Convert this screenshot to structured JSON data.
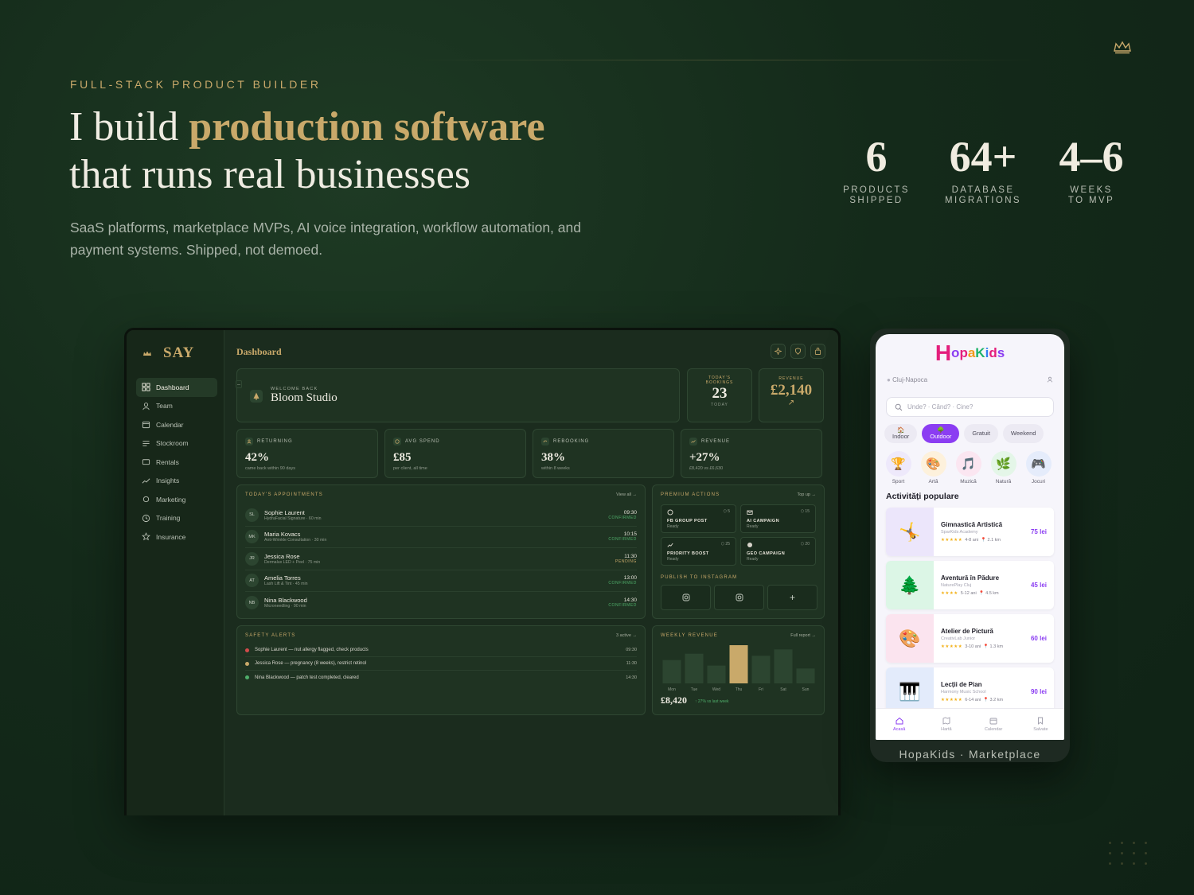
{
  "hero": {
    "eyebrow": "FULL-STACK PRODUCT BUILDER",
    "headline_pre": "I build ",
    "headline_highlight": "production software",
    "headline_line2": "that runs real businesses",
    "subcopy": "SaaS platforms, marketplace MVPs, AI voice integration, workflow automation, and payment systems. Shipped, not demoed.",
    "accent_color": "#c9a96a"
  },
  "stats": [
    {
      "value": "6",
      "label1": "PRODUCTS",
      "label2": "SHIPPED"
    },
    {
      "value": "64+",
      "label1": "DATABASE",
      "label2": "MIGRATIONS"
    },
    {
      "value": "4–6",
      "label1": "WEEKS",
      "label2": "TO MVP"
    }
  ],
  "dashboard": {
    "brand": "SAY",
    "page_title": "Dashboard",
    "nav": [
      {
        "label": "Dashboard",
        "icon": "grid-icon"
      },
      {
        "label": "Team",
        "icon": "user-icon"
      },
      {
        "label": "Calendar",
        "icon": "calendar-icon"
      },
      {
        "label": "Stockroom",
        "icon": "list-icon"
      },
      {
        "label": "Rentals",
        "icon": "box-icon"
      },
      {
        "label": "Insights",
        "icon": "trend-icon"
      },
      {
        "label": "Marketing",
        "icon": "megaphone-icon"
      },
      {
        "label": "Training",
        "icon": "clock-icon"
      },
      {
        "label": "Insurance",
        "icon": "star-icon"
      }
    ],
    "welcome": {
      "label": "WELCOME BACK",
      "name": "Bloom Studio"
    },
    "bookings": {
      "label": "TODAY'S BOOKINGS",
      "value": "23",
      "sub": "TODAY"
    },
    "revenue": {
      "label": "REVENUE",
      "value": "£2,140",
      "arrow": "↗"
    },
    "kpis": [
      {
        "label": "RETURNING",
        "value": "42%",
        "sub": "came back within 90 days"
      },
      {
        "label": "AVG SPEND",
        "value": "£85",
        "sub": "per client, all time"
      },
      {
        "label": "REBOOKING",
        "value": "38%",
        "sub": "within 8 weeks"
      },
      {
        "label": "REVENUE",
        "value": "+27%",
        "sub": "£8,420 vs £6,630"
      }
    ],
    "appointments": {
      "title": "TODAY'S APPOINTMENTS",
      "link": "View all →",
      "items": [
        {
          "initials": "SL",
          "name": "Sophie Laurent",
          "treatment": "HydraFacial Signature · 60 min",
          "time": "09:30",
          "status": "CONFIRMED"
        },
        {
          "initials": "MK",
          "name": "Maria Kovacs",
          "treatment": "Anti-Wrinkle Consultation · 30 min",
          "time": "10:15",
          "status": "CONFIRMED"
        },
        {
          "initials": "JR",
          "name": "Jessica Rose",
          "treatment": "Dermalux LED + Peel · 75 min",
          "time": "11:30",
          "status": "PENDING"
        },
        {
          "initials": "AT",
          "name": "Amelia Torres",
          "treatment": "Lash Lift & Tint · 45 min",
          "time": "13:00",
          "status": "CONFIRMED"
        },
        {
          "initials": "NB",
          "name": "Nina Blackwood",
          "treatment": "Microneedling · 90 min",
          "time": "14:30",
          "status": "CONFIRMED"
        }
      ]
    },
    "premium": {
      "title": "PREMIUM ACTIONS",
      "link": "Top up →",
      "actions": [
        {
          "title": "FB GROUP POST",
          "state": "Ready",
          "cost": "⬡ 5"
        },
        {
          "title": "AI CAMPAIGN",
          "state": "Ready",
          "cost": "⬡ 15"
        },
        {
          "title": "PRIORITY BOOST",
          "state": "Ready",
          "cost": "⬡ 25"
        },
        {
          "title": "GEO CAMPAIGN",
          "state": "Ready",
          "cost": "⬡ 20"
        }
      ],
      "publish_title": "PUBLISH TO INSTAGRAM",
      "plus": "+"
    },
    "alerts": {
      "title": "SAFETY ALERTS",
      "link": "3 active →",
      "items": [
        {
          "text": "Sophie Laurent — nut allergy flagged, check products",
          "time": "09:30",
          "color": "#d24b4b"
        },
        {
          "text": "Jessica Rose — pregnancy (8 weeks), restrict retinol",
          "time": "11:30",
          "color": "#c9a96a"
        },
        {
          "text": "Nina Blackwood — patch test completed, cleared",
          "time": "14:30",
          "color": "#4fae6a"
        }
      ]
    },
    "weekly": {
      "title": "WEEKLY REVENUE",
      "link": "Full report →",
      "total": "£8,420",
      "delta": "↑ 27% vs last week"
    }
  },
  "chart_data": {
    "type": "bar",
    "categories": [
      "Mon",
      "Tue",
      "Wed",
      "Thu",
      "Fri",
      "Sat",
      "Sun"
    ],
    "values": [
      55,
      70,
      42,
      90,
      65,
      80,
      35
    ],
    "highlight_index": 3,
    "title": "WEEKLY REVENUE",
    "bar_color": "#2c4530",
    "highlight_color": "#c9a96a"
  },
  "phone": {
    "logo_h": "H",
    "logo_rest": "opaKids",
    "location": "Cluj-Napoca",
    "search_placeholder": "Unde? · Când? · Cine?",
    "chips": [
      {
        "icon": "🏠",
        "label": "Indoor"
      },
      {
        "icon": "🌳",
        "label": "Outdoor"
      },
      {
        "icon": "",
        "label": "Gratuit"
      },
      {
        "icon": "",
        "label": "Weekend"
      }
    ],
    "categories": [
      {
        "icon": "🏆",
        "label": "Sport",
        "bg": "#eee9fb"
      },
      {
        "icon": "🎨",
        "label": "Artă",
        "bg": "#fdf1dc"
      },
      {
        "icon": "🎵",
        "label": "Muzică",
        "bg": "#fbe6f1"
      },
      {
        "icon": "🌿",
        "label": "Natură",
        "bg": "#e4f6e8"
      },
      {
        "icon": "🎮",
        "label": "Jocuri",
        "bg": "#e5ecfb"
      }
    ],
    "section_title": "Activități populare",
    "activities": [
      {
        "icon": "🤸",
        "name": "Gimnastică Artistică",
        "org": "SparKids Academy",
        "stars": "★★★★★",
        "age": "4-8 ani",
        "dist": "📍 2.1 km",
        "price": "75 lei",
        "bg": "#ece6fb"
      },
      {
        "icon": "🌲",
        "name": "Aventură în Pădure",
        "org": "NaturePlay Cluj",
        "stars": "★★★★",
        "age": "5-12 ani",
        "dist": "📍 4.5 km",
        "price": "45 lei",
        "bg": "#dcf6e6"
      },
      {
        "icon": "🎨",
        "name": "Atelier de Pictură",
        "org": "CreativLab Junior",
        "stars": "★★★★★",
        "age": "3-10 ani",
        "dist": "📍 1.3 km",
        "price": "60 lei",
        "bg": "#fbe4ef"
      },
      {
        "icon": "🎹",
        "name": "Lecții de Pian",
        "org": "Harmony Music School",
        "stars": "★★★★★",
        "age": "6-14 ani",
        "dist": "📍 3.2 km",
        "price": "90 lei",
        "bg": "#e3ebfb"
      }
    ],
    "tabs": [
      "Acasă",
      "Hartă",
      "Calendar",
      "Salvate"
    ],
    "caption": "HopaKids · Marketplace",
    "accent_color": "#8b3df2"
  }
}
